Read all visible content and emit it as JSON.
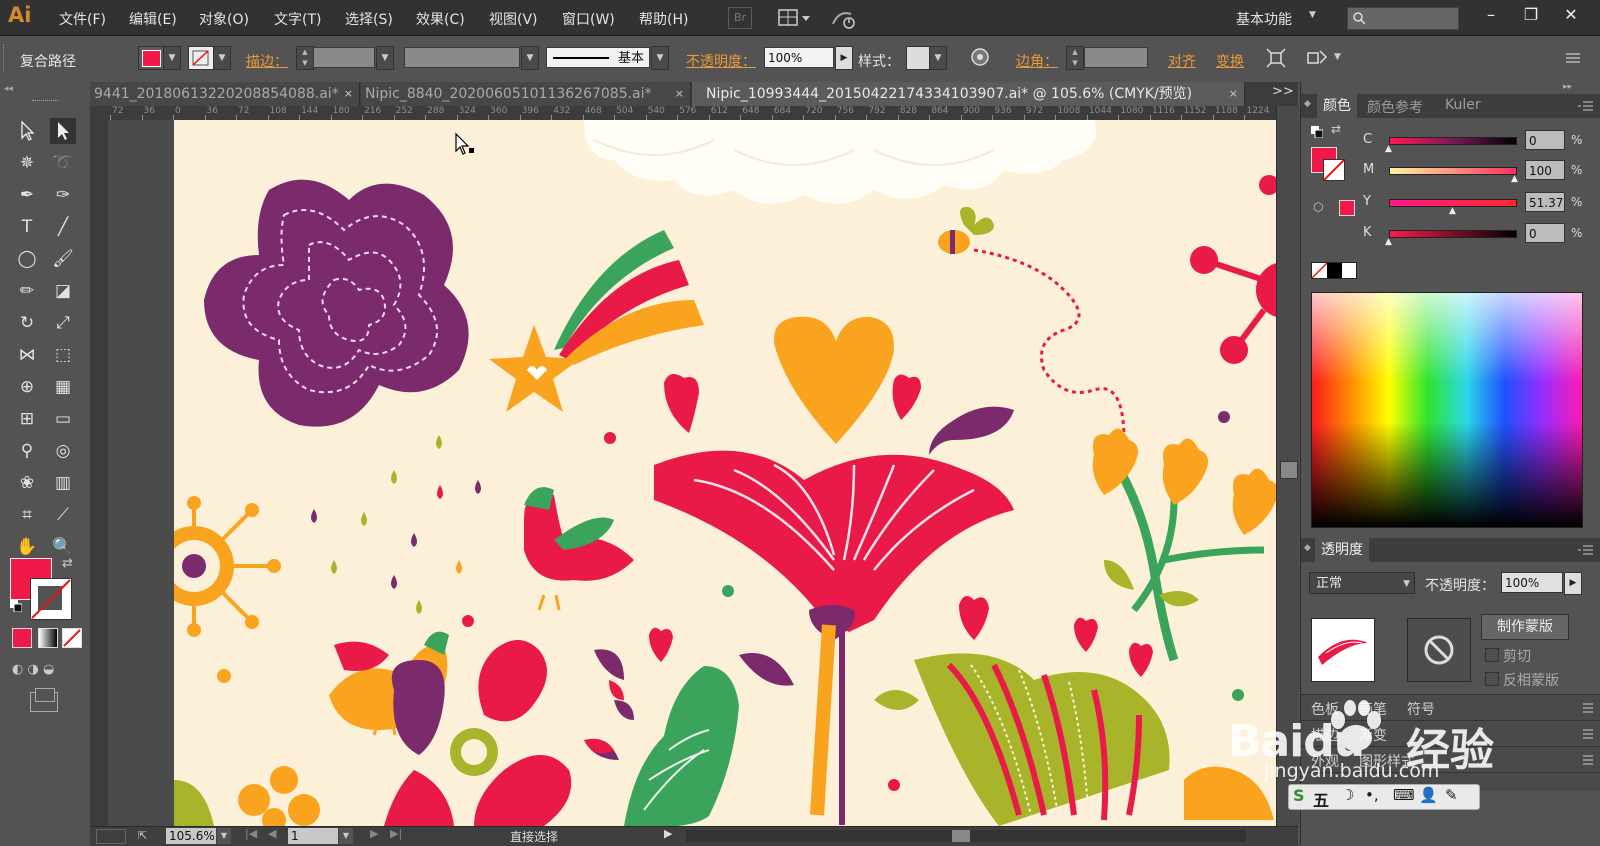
{
  "app": {
    "logo": "Ai"
  },
  "menu": [
    "文件(F)",
    "编辑(E)",
    "对象(O)",
    "文字(T)",
    "选择(S)",
    "效果(C)",
    "视图(V)",
    "窗口(W)",
    "帮助(H)"
  ],
  "topbar": {
    "bridge_label": "Br",
    "workspace": "基本功能"
  },
  "control_bar": {
    "object_type": "复合路径",
    "stroke_label": "描边：",
    "stroke_style": "基本",
    "opacity_label": "不透明度：",
    "opacity_value": "100%",
    "style_label": "样式：",
    "corner_label": "边角：",
    "align_label": "对齐",
    "transform_label": "变换",
    "fill_color": "#f0194a"
  },
  "tabs": [
    {
      "label": "9441_20180613220208854088.ai*",
      "close": "×"
    },
    {
      "label": "Nipic_8840_20200605101136267085.ai*",
      "close": "×"
    },
    {
      "label": "Nipic_10993444_20150422174334103907.ai* @ 105.6% (CMYK/预览)",
      "close": "×"
    }
  ],
  "tab_overflow": ">>",
  "ruler_ticks": [
    "72",
    "36",
    "0",
    "36",
    "72",
    "108",
    "144",
    "180",
    "216",
    "252",
    "288",
    "324",
    "360",
    "396",
    "432",
    "468",
    "504",
    "540",
    "576",
    "612",
    "648",
    "684",
    "720",
    "756",
    "792",
    "828",
    "864",
    "900",
    "936",
    "972",
    "1008",
    "1044",
    "1080",
    "1116",
    "1152",
    "1188",
    "1224"
  ],
  "status": {
    "zoom": "105.6%",
    "artboard": "1",
    "tool_name": "直接选择"
  },
  "color_panel": {
    "tabs": [
      "颜色",
      "颜色参考",
      "Kuler"
    ],
    "channels": [
      {
        "label": "C",
        "value": "0",
        "unit": "%"
      },
      {
        "label": "M",
        "value": "100",
        "unit": "%"
      },
      {
        "label": "Y",
        "value": "51.37",
        "unit": "%"
      },
      {
        "label": "K",
        "value": "0",
        "unit": "%"
      }
    ],
    "fill_color": "#f0194a"
  },
  "transparency_panel": {
    "title": "透明度",
    "blend_mode": "正常",
    "opacity_label": "不透明度：",
    "opacity_value": "100%",
    "make_mask_label": "制作蒙版",
    "clip_label": "剪切",
    "invert_label": "反相蒙版"
  },
  "collapsed_panels": [
    {
      "tabs": [
        "色板",
        "画笔",
        "符号"
      ]
    },
    {
      "tabs": [
        "描边",
        "渐变"
      ]
    },
    {
      "tabs": [
        "外观",
        "图形样式"
      ]
    }
  ],
  "watermark": {
    "brand": "Baidu",
    "text": "经验",
    "url": "jingyan.baidu.com",
    "ime_label": "五"
  }
}
